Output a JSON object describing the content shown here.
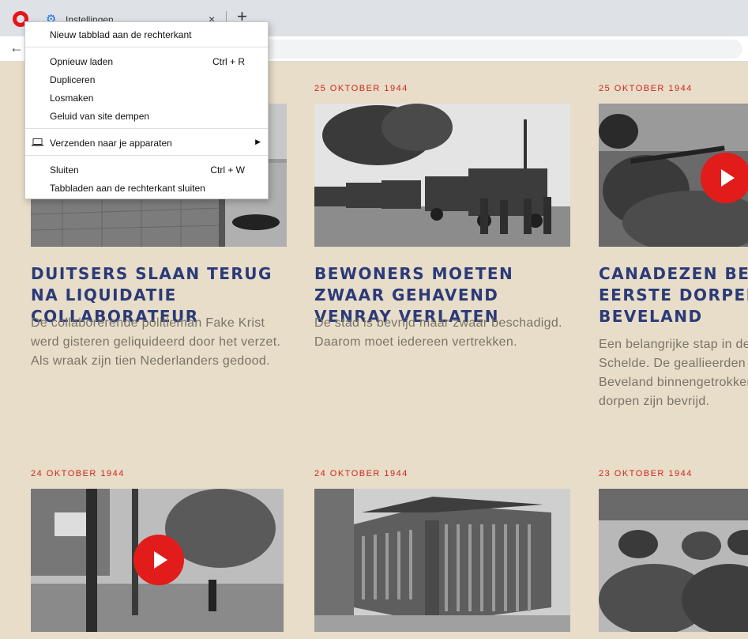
{
  "browser": {
    "tab_title": "Instellingen",
    "tab_close": "×",
    "new_tab": "+",
    "back": "←"
  },
  "context_menu": {
    "items": [
      {
        "label": "Nieuw tabblad aan de rechterkant",
        "shortcut": ""
      },
      {
        "label": "Opnieuw laden",
        "shortcut": "Ctrl + R"
      },
      {
        "label": "Dupliceren",
        "shortcut": ""
      },
      {
        "label": "Losmaken",
        "shortcut": ""
      },
      {
        "label": "Geluid van site dempen",
        "shortcut": ""
      },
      {
        "label": "Verzenden naar je apparaten",
        "shortcut": "",
        "submenu_arrow": "▶"
      },
      {
        "label": "Sluiten",
        "shortcut": "Ctrl + W"
      },
      {
        "label": "Tabbladen aan de rechterkant sluiten",
        "shortcut": ""
      }
    ]
  },
  "articles": [
    {
      "date": "",
      "headline": "Duitsers slaan terug na liquidatie collaborateur",
      "summary": "De collaborerende politieman Fake Krist werd gisteren geliquideerd door het verzet. Als wraak zijn tien Nederlanders gedood.",
      "has_video": false
    },
    {
      "date": "25 oktober 1944",
      "headline": "Bewoners moeten zwaar gehavend Venray verlaten",
      "summary": "De stad is bevrijd maar zwaar beschadigd. Daarom moet iedereen vertrekken.",
      "has_video": false
    },
    {
      "date": "25 oktober 1944",
      "headline": "Canadezen bevrijden eerste dorpen Zuid-Beveland",
      "summary": "Een belangrijke stap in de strijd om de Schelde. De geallieerden zijn Zuid-Beveland binnengetrokken en de eerste dorpen zijn bevrijd.",
      "has_video": true
    },
    {
      "date": "24 oktober 1944",
      "headline": "",
      "summary": "",
      "has_video": true
    },
    {
      "date": "24 oktober 1944",
      "headline": "",
      "summary": "",
      "has_video": false
    },
    {
      "date": "23 oktober 1944",
      "headline": "",
      "summary": "",
      "has_video": false
    }
  ],
  "colors": {
    "page_bg": "#e7ddc8",
    "date_red": "#d0261d",
    "headline_blue": "#2b3a78",
    "play_red": "#e21b1b",
    "body_grey": "#7a7468"
  }
}
